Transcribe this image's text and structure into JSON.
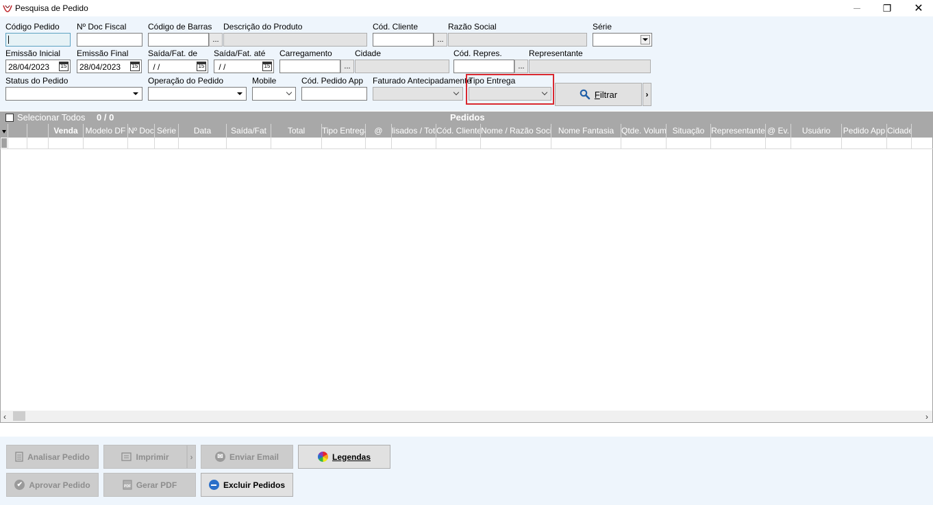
{
  "window": {
    "title": "Pesquisa de Pedido",
    "minimize": "—",
    "restore": "❐",
    "close": "✕"
  },
  "filters": {
    "codigo_pedido_label": "Código Pedido",
    "codigo_pedido_value": "",
    "n_doc_fiscal_label": "Nº Doc Fiscal",
    "n_doc_fiscal_value": "",
    "codigo_barras_label": "Código de Barras",
    "codigo_barras_value": "",
    "descricao_produto_label": "Descrição do Produto",
    "descricao_produto_value": "",
    "cod_cliente_label": "Cód. Cliente",
    "cod_cliente_value": "",
    "razao_social_label": "Razão Social",
    "razao_social_value": "",
    "serie_label": "Série",
    "serie_value": "",
    "emissao_inicial_label": "Emissão Inicial",
    "emissao_inicial_value": "28/04/2023",
    "emissao_final_label": "Emissão Final",
    "emissao_final_value": "28/04/2023",
    "saida_fat_de_label": "Saída/Fat. de",
    "saida_fat_de_value": " / /",
    "saida_fat_ate_label": "Saída/Fat. até",
    "saida_fat_ate_value": " / /",
    "carregamento_label": "Carregamento",
    "carregamento_value": "",
    "cidade_label": "Cidade",
    "cidade_value": "",
    "cod_repres_label": "Cód. Repres.",
    "cod_repres_value": "",
    "representante_label": "Representante",
    "representante_value": "",
    "status_pedido_label": "Status do Pedido",
    "status_pedido_value": "",
    "operacao_pedido_label": "Operação do Pedido",
    "operacao_pedido_value": "",
    "mobile_label": "Mobile",
    "mobile_value": "",
    "cod_pedido_app_label": "Cód. Pedido App",
    "cod_pedido_app_value": "",
    "faturado_antecipadamente_label": "Faturado Antecipadamente",
    "faturado_antecipadamente_value": "",
    "tipo_entrega_label": "Tipo Entrega",
    "tipo_entrega_value": "",
    "ellipsis": "...",
    "calendar_glyph": "15",
    "filtrar_label_first": "F",
    "filtrar_label_rest": "iltrar",
    "more_glyph": "›"
  },
  "grid": {
    "select_all_label": "Selecionar Todos",
    "count": "0 / 0",
    "title": "Pedidos",
    "columns": [
      {
        "label": "",
        "bold": false
      },
      {
        "label": "",
        "bold": false
      },
      {
        "label": "Venda",
        "bold": true
      },
      {
        "label": "Modelo DF",
        "bold": false
      },
      {
        "label": "Nº Doc. Fiscal",
        "bold": false
      },
      {
        "label": "Série",
        "bold": false
      },
      {
        "label": "Data",
        "bold": false
      },
      {
        "label": "Saída/Fat",
        "bold": false
      },
      {
        "label": "Total",
        "bold": false
      },
      {
        "label": "Tipo Entrega",
        "bold": false
      },
      {
        "label": "@",
        "bold": false
      },
      {
        "label": "lisados / Total",
        "bold": false
      },
      {
        "label": "Cód. Cliente",
        "bold": false
      },
      {
        "label": "Nome / Razão Social",
        "bold": false
      },
      {
        "label": "Nome Fantasia",
        "bold": false
      },
      {
        "label": "Qtde. Volume",
        "bold": false
      },
      {
        "label": "Situação",
        "bold": false
      },
      {
        "label": "Representante",
        "bold": false
      },
      {
        "label": "@ Ev.",
        "bold": false
      },
      {
        "label": "Usuário",
        "bold": false
      },
      {
        "label": "Pedido App",
        "bold": false
      },
      {
        "label": "Cidade",
        "bold": false
      }
    ]
  },
  "buttons": {
    "analisar_pedido": "Analisar Pedido",
    "imprimir": "Imprimir",
    "enviar_email": "Enviar Email",
    "legendas": "Legendas",
    "aprovar_pedido": "Aprovar Pedido",
    "gerar_pdf": "Gerar PDF",
    "excluir_pedidos": "Excluir Pedidos",
    "imprimir_more": "›"
  },
  "colors": {
    "highlight": "#d9272e",
    "grid_header": "#a8a8a8",
    "panel_bg": "#eef5fc",
    "excluir_icon": "#2a6fc9"
  }
}
